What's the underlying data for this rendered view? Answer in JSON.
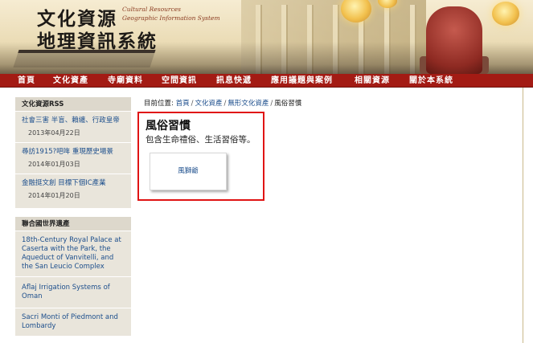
{
  "header": {
    "title_zh_line1": "文化資源",
    "title_zh_line2": "地理資訊系統",
    "title_en_line1": "Cultural Resources",
    "title_en_line2": "Geographic Information System"
  },
  "nav": {
    "items": [
      "首頁",
      "文化資產",
      "寺廟資料",
      "空間資訊",
      "訊息快遞",
      "應用議題與案例",
      "相關資源",
      "關於本系統"
    ]
  },
  "sidebar": {
    "rss": {
      "heading": "文化資源RSS",
      "items": [
        {
          "title": "社會三害 半盲、賴纏、行政皇帝",
          "date": "2013年04月22日"
        },
        {
          "title": "尋訪1915?吧哖 重現歷史場景",
          "date": "2014年01月03日"
        },
        {
          "title": "金融挺文創 目標下個IC產業",
          "date": "2014年01月20日"
        }
      ]
    },
    "heritage": {
      "heading": "聯合國世界遺產",
      "items": [
        "18th-Century Royal Palace at Caserta with the Park, the Aqueduct of Vanvitelli, and the San Leucio Complex",
        "Aflaj Irrigation Systems of Oman",
        "Sacri Monti of Piedmont and Lombardy"
      ]
    }
  },
  "breadcrumb": {
    "prefix": "目前位置:",
    "links": [
      "首頁",
      "文化資產",
      "無形文化資產"
    ],
    "current": "風俗習慣"
  },
  "content": {
    "title": "風俗習慣",
    "description": "包含生命禮俗、生活習俗等。",
    "card_label": "風獅爺"
  }
}
